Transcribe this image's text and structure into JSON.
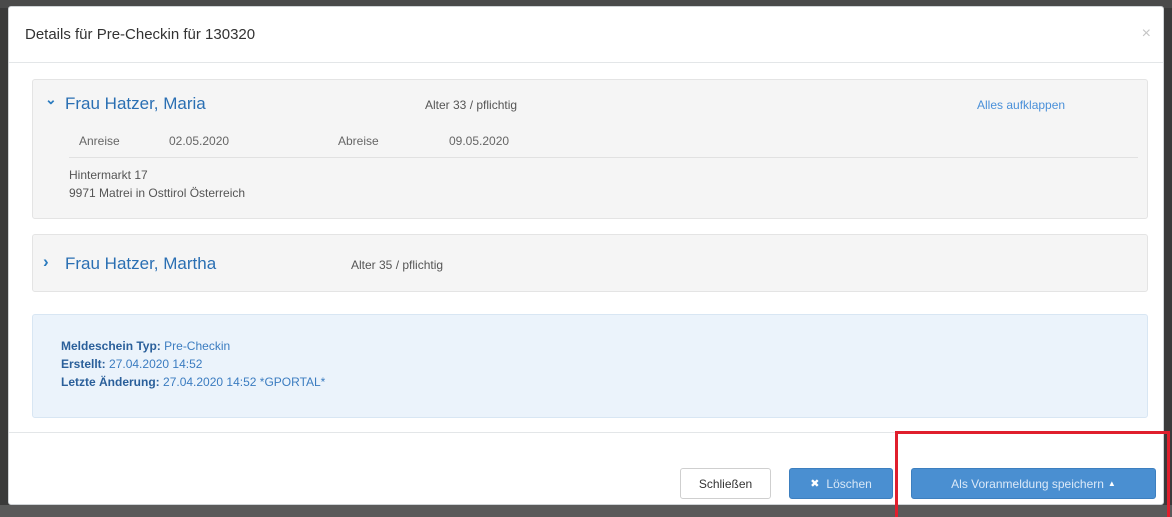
{
  "modal": {
    "title": "Details für Pre-Checkin für 130320",
    "close_symbol": "×"
  },
  "guests": [
    {
      "name": "Frau Hatzer, Maria",
      "expanded": true,
      "chevron": "⌄",
      "age": "Alter 33 / pflichtig",
      "expand_all": "Alles aufklappen",
      "arrival_label": "Anreise",
      "arrival": "02.05.2020",
      "departure_label": "Abreise",
      "departure": "09.05.2020",
      "street": "Hintermarkt 17",
      "city": "9971 Matrei in Osttirol Österreich"
    },
    {
      "name": "Frau Hatzer, Martha",
      "expanded": false,
      "chevron": "›",
      "age": "Alter 35 / pflichtig"
    }
  ],
  "info": {
    "type_label": "Meldeschein Typ:",
    "type_value": "Pre-Checkin",
    "created_label": "Erstellt:",
    "created_value": "27.04.2020 14:52",
    "changed_label": "Letzte Änderung:",
    "changed_value": "27.04.2020 14:52 *GPORTAL*"
  },
  "footer": {
    "close_label": "Schließen",
    "delete_label": "Löschen",
    "delete_icon": "✖",
    "save_label": "Als Voranmeldung speichern",
    "save_caret": "▲"
  },
  "colors": {
    "accent": "#4a8fd1",
    "link": "#2a6fb3",
    "highlight": "#e01f2d",
    "info_bg": "#ebf3fb"
  }
}
